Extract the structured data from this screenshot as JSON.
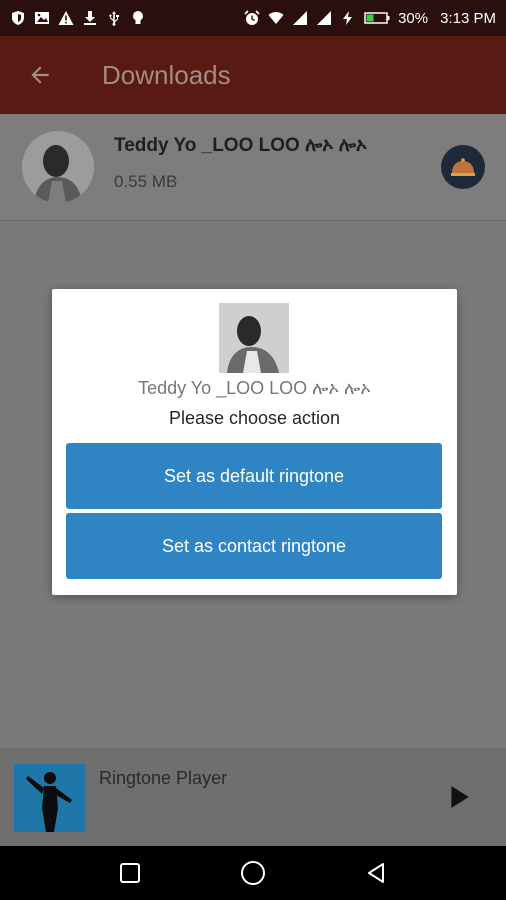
{
  "status_bar": {
    "battery": "30%",
    "time": "3:13 PM",
    "left_icons": [
      "shield-icon",
      "image-icon",
      "warning-icon",
      "download-icon",
      "usb-icon",
      "lightbulb-icon"
    ],
    "right_icons": [
      "alarm-icon",
      "wifi-icon",
      "signal-icon",
      "signal-icon",
      "charging-icon",
      "battery-icon"
    ]
  },
  "app_bar": {
    "title": "Downloads",
    "back_icon": "arrow-back-icon"
  },
  "download_item": {
    "title": "Teddy Yo _LOO LOO ሎኦ ሎኦ",
    "size": "0.55 MB",
    "action_icon": "bell-icon"
  },
  "dialog": {
    "title": "Teddy Yo _LOO LOO ሎኦ ሎኦ",
    "subtitle": "Please choose action",
    "buttons": {
      "default_ringtone": "Set as default ringtone",
      "contact_ringtone": "Set as contact ringtone"
    }
  },
  "player": {
    "label": "Ringtone Player",
    "play_icon": "play-icon"
  },
  "nav_bar": {
    "icons": [
      "recents-icon",
      "home-icon",
      "back-icon"
    ]
  },
  "colors": {
    "status_bar": "#2a0f0d",
    "app_bar": "#5a1a14",
    "dialog_button": "#2f84c4",
    "scrim_background": "#7a7a7a"
  }
}
